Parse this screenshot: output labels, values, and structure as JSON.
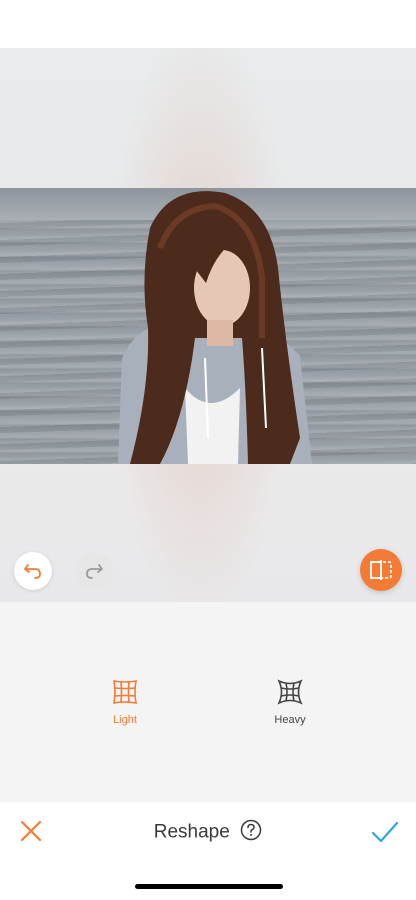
{
  "editor": {
    "image_description": "portrait photo on wooden dock"
  },
  "history": {
    "undo_icon": "undo-arrow",
    "redo_icon": "redo-arrow"
  },
  "compare": {
    "icon": "compare-split"
  },
  "tools": [
    {
      "label": "Light",
      "icon": "grid-light",
      "active": true
    },
    {
      "label": "Heavy",
      "icon": "grid-heavy",
      "active": false
    }
  ],
  "bottom_bar": {
    "title": "Reshape",
    "help_icon": "question-circle",
    "cancel_icon": "close-x",
    "apply_icon": "checkmark"
  },
  "colors": {
    "accent": "#f47b35",
    "apply": "#2aa8e0",
    "text": "#3a3a3a"
  }
}
